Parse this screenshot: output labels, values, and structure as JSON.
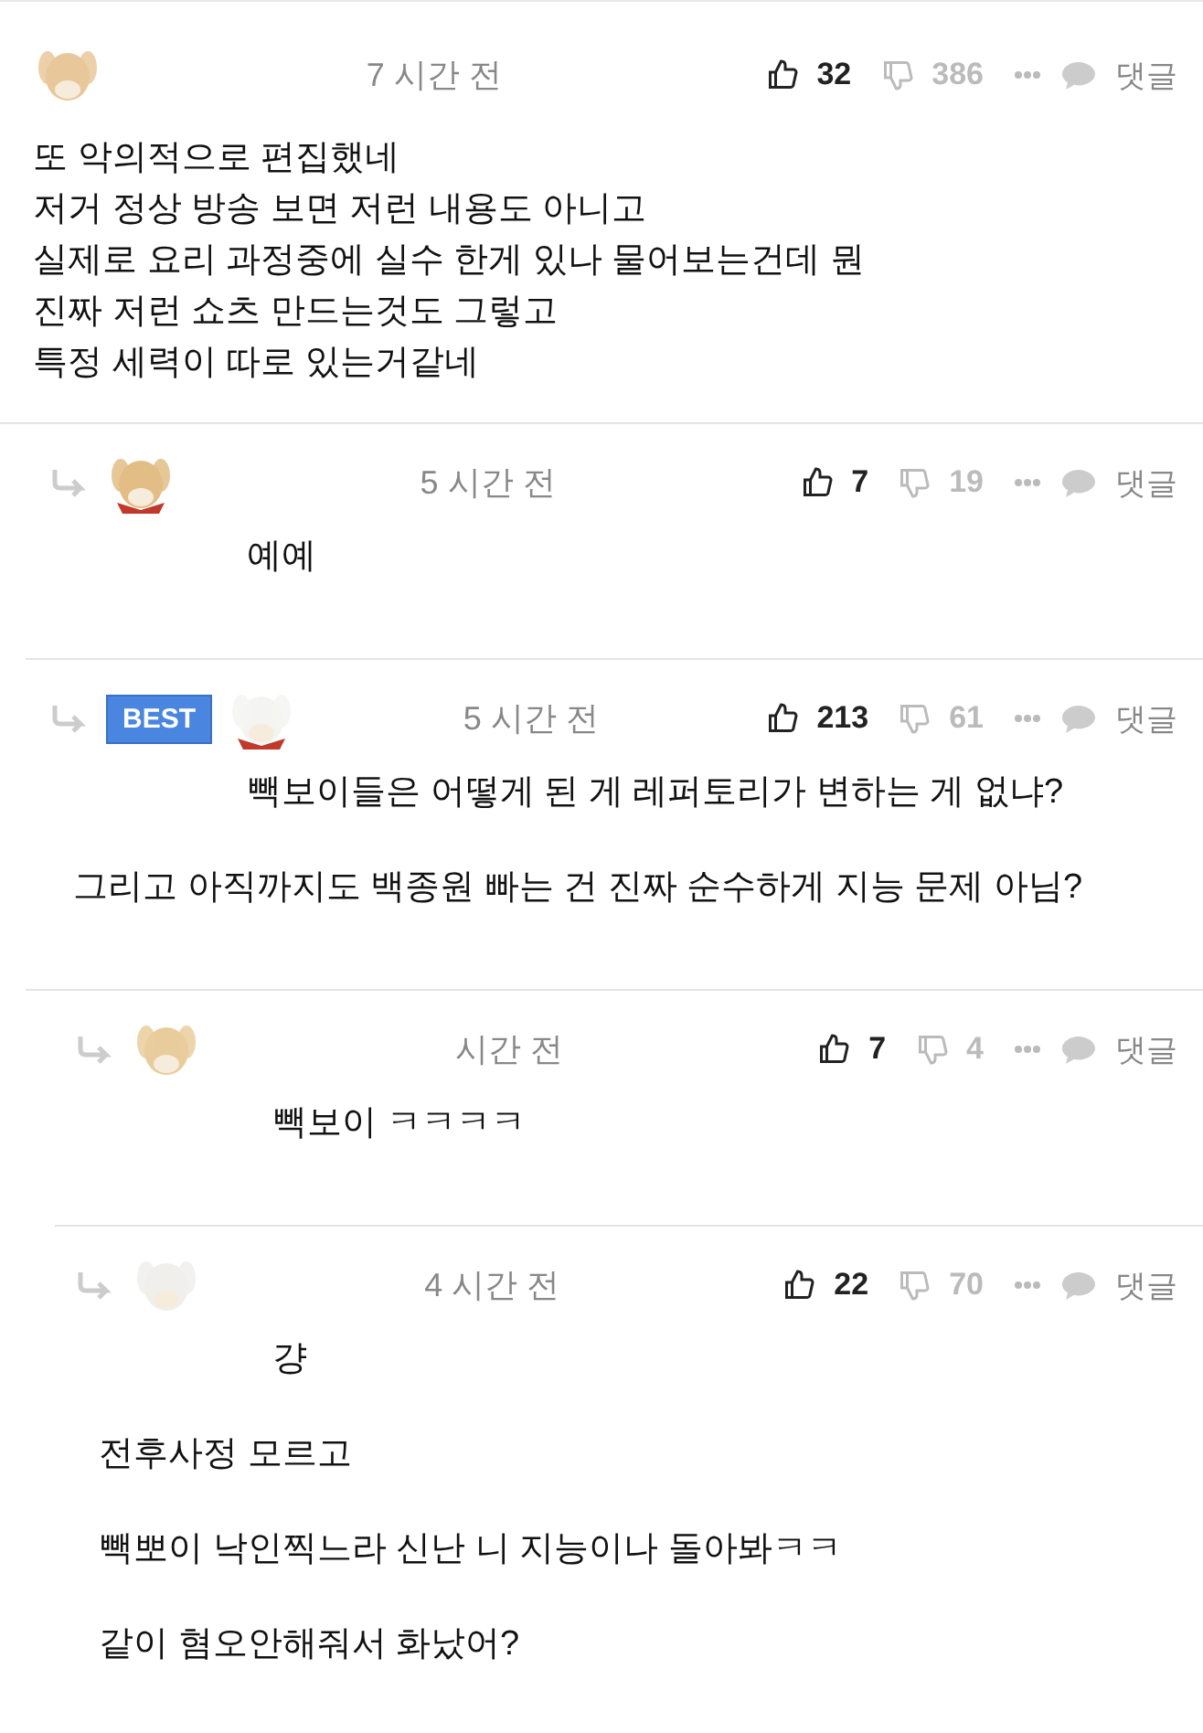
{
  "comments": [
    {
      "avatar": {
        "kind": "picture"
      },
      "time": "7 시간 전",
      "likes": "32",
      "dislikes": "386",
      "reply_label": "댓글",
      "paragraphs": [
        "또 악의적으로 편집했네\n저거 정상 방송 보면 저런 내용도 아니고\n실제로 요리 과정중에 실수 한게 있나 물어보는건데 뭔\n진짜 저런 쇼츠 만드는것도 그렇고\n특정 세력이 따로 있는거같네"
      ],
      "children": [
        {
          "avatar": {
            "kind": "picture"
          },
          "time": "5 시간 전",
          "likes": "7",
          "dislikes": "19",
          "reply_label": "댓글",
          "paragraphs": [
            "예예"
          ]
        },
        {
          "avatar": {
            "kind": "picture"
          },
          "time": "5 시간 전",
          "likes": "213",
          "dislikes": "61",
          "reply_label": "댓글",
          "badge": "BEST",
          "paragraphs": [
            "빽보이들은 어떻게 된 게 레퍼토리가 변하는 게 없냐?",
            "그리고 아직까지도 백종원 빠는 건 진짜 순수하게 지능 문제 아님?"
          ],
          "children": [
            {
              "avatar": {
                "kind": "picture"
              },
              "time": "시간 전",
              "likes": "7",
              "dislikes": "4",
              "reply_label": "댓글",
              "paragraphs": [
                "빽보이 ㅋㅋㅋㅋ"
              ]
            },
            {
              "avatar": {
                "kind": "picture"
              },
              "time": "4 시간 전",
              "likes": "22",
              "dislikes": "70",
              "reply_label": "댓글",
              "paragraphs": [
                "걍",
                "전후사정 모르고",
                "빽뽀이 낙인찍느라 신난 니 지능이나 돌아봐ㅋㅋ",
                "같이 혐오안해줘서 화났어?"
              ]
            }
          ]
        }
      ]
    }
  ]
}
